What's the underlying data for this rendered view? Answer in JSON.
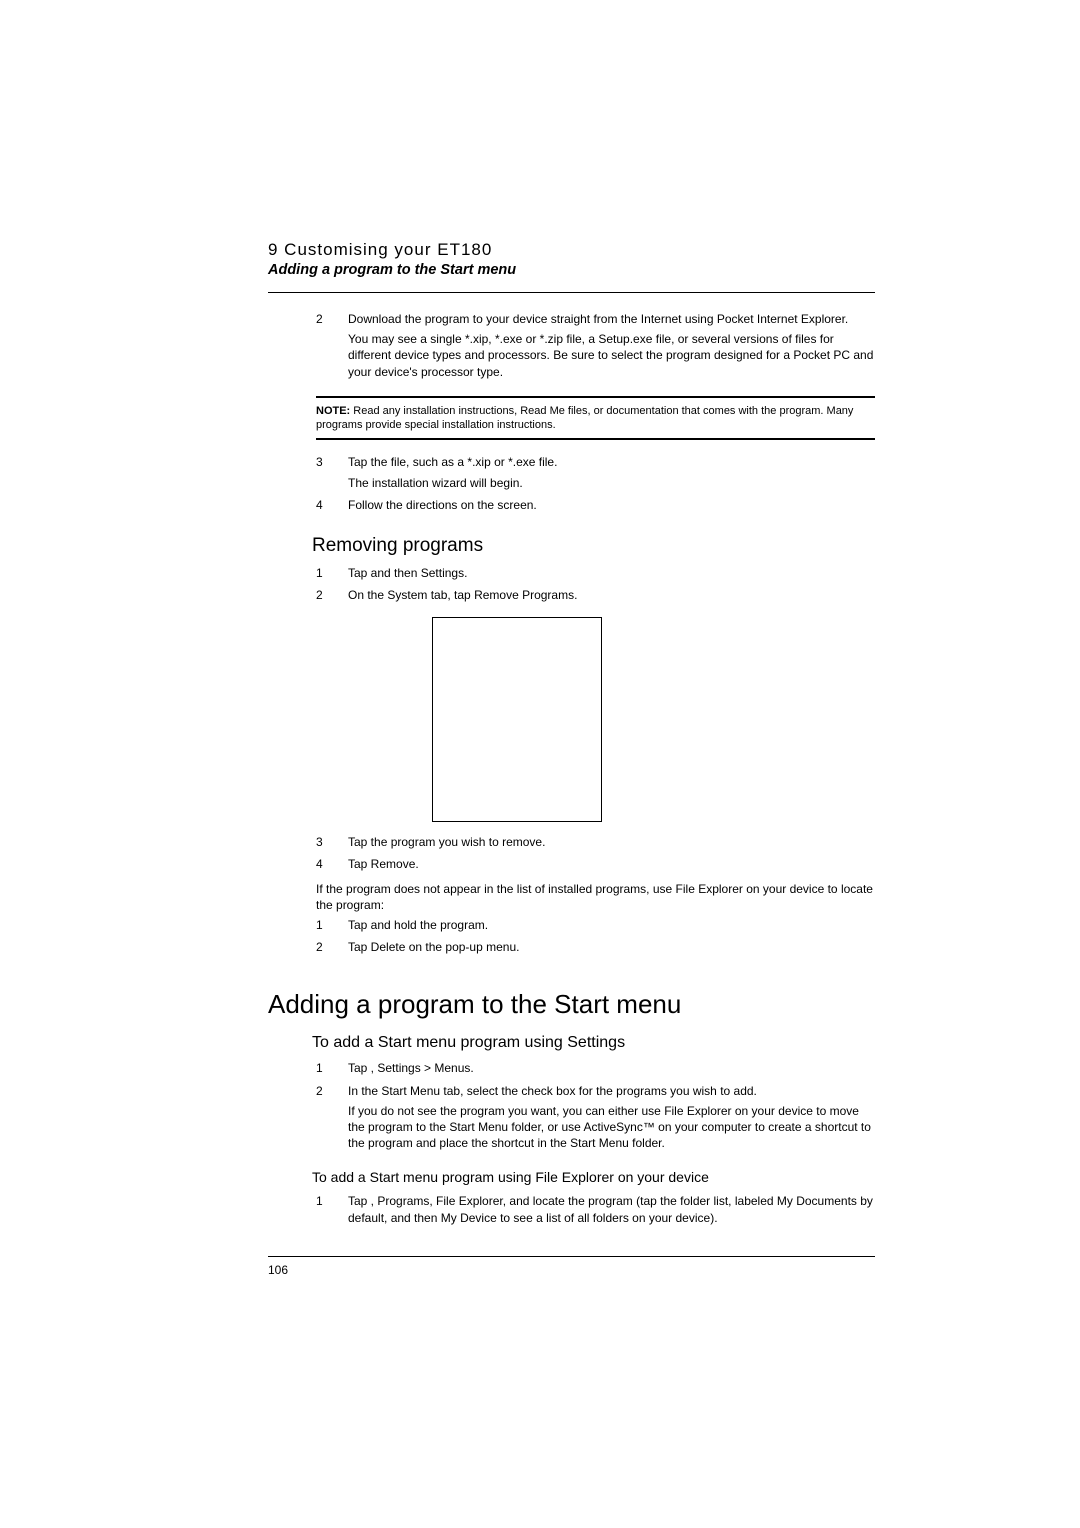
{
  "header": {
    "chapter": "9 Customising your ET180",
    "section": "Adding a program to the Start menu"
  },
  "top_steps": [
    {
      "num": "2",
      "paras": [
        "Download the program to your device straight from the Internet using Pocket Internet Explorer.",
        "You may see a single *.xip,  *.exe or *.zip file, a Setup.exe file, or several versions of files for different device types and processors. Be sure to select the program designed for a Pocket PC and your device's processor type."
      ]
    }
  ],
  "note": {
    "label": "NOTE:",
    "text": "   Read any installation instructions, Read Me files, or documentation that comes with the program. Many programs provide special installation instructions."
  },
  "after_note_steps": [
    {
      "num": "3",
      "paras": [
        "Tap the file, such as a *.xip or *.exe file.",
        "The installation wizard will begin."
      ]
    },
    {
      "num": "4",
      "paras": [
        "Follow the directions on the screen."
      ]
    }
  ],
  "removing": {
    "heading": "Removing programs",
    "steps_a": [
      {
        "num": "1",
        "paras": [
          "Tap       and then Settings."
        ]
      },
      {
        "num": "2",
        "paras": [
          "On the System tab, tap Remove Programs."
        ]
      }
    ],
    "steps_b": [
      {
        "num": "3",
        "paras": [
          "Tap the program you wish to remove."
        ]
      },
      {
        "num": "4",
        "paras": [
          "Tap Remove."
        ]
      }
    ],
    "para": "If the program does not appear in the list of installed programs, use File Explorer on your device to locate the program:",
    "steps_c": [
      {
        "num": "1",
        "paras": [
          "Tap and hold the program."
        ]
      },
      {
        "num": "2",
        "paras": [
          "Tap Delete on the pop-up menu."
        ]
      }
    ]
  },
  "adding": {
    "h1": "Adding a program to the Start menu",
    "sub1": {
      "heading": "To add a Start menu program using Settings",
      "steps": [
        {
          "num": "1",
          "paras": [
            "Tap       , Settings > Menus."
          ]
        },
        {
          "num": "2",
          "paras": [
            "In the Start Menu tab, select the check box for the programs you wish to add.",
            "If you do not see the program you want, you can either use File Explorer on your device to move the program to the Start Menu folder, or use ActiveSync™ on your computer to create a shortcut to the program and place the shortcut in the Start Menu folder."
          ]
        }
      ]
    },
    "sub2": {
      "heading": "To add a Start menu program using File Explorer on your device",
      "steps": [
        {
          "num": "1",
          "paras": [
            "Tap       , Programs, File Explorer, and locate the program (tap the folder list, labeled My Documents by default, and then My Device to see a list of all folders on your device)."
          ]
        }
      ]
    }
  },
  "page_number": "106"
}
